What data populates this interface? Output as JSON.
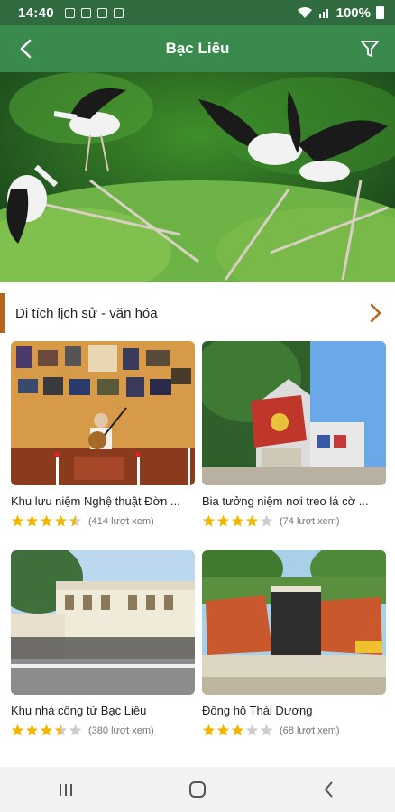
{
  "status": {
    "time": "14:40",
    "battery": "100%"
  },
  "header": {
    "title": "Bạc Liêu"
  },
  "section": {
    "title": "Di tích lịch sử - văn hóa"
  },
  "cards": [
    {
      "name": "Khu lưu niệm Nghệ thuật Đờn ...",
      "rating": 4.5,
      "views": "(414 lượt xem)"
    },
    {
      "name": "Bia tưởng niệm nơi treo lá cờ ...",
      "rating": 4,
      "views": "(74 lượt xem)"
    },
    {
      "name": "Khu nhà công tử Bạc Liêu",
      "rating": 3.5,
      "views": "(380 lượt xem)"
    },
    {
      "name": "Đồng hồ Thái Dương",
      "rating": 3,
      "views": "(68 lượt xem)"
    }
  ],
  "colors": {
    "statusbar": "#2f6b3f",
    "appbar": "#3a8a4e",
    "accent": "#b8651c",
    "star": "#f2b600",
    "star_empty": "#cccccc"
  }
}
